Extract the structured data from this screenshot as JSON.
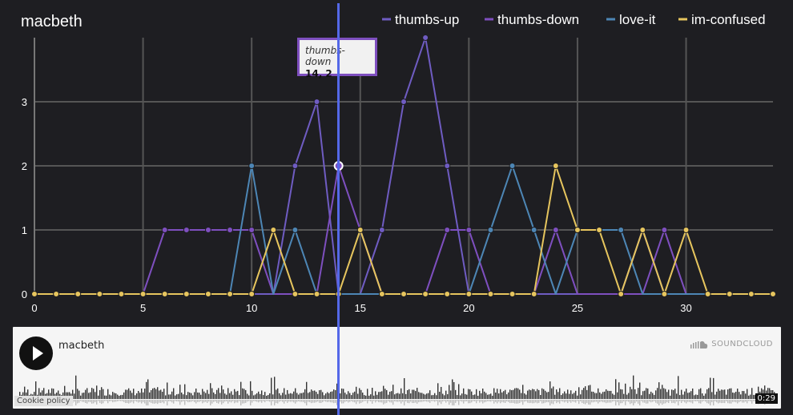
{
  "chart_data": {
    "type": "line",
    "title": "macbeth",
    "xlabel": "",
    "ylabel": "",
    "xlim": [
      0,
      34
    ],
    "ylim": [
      0,
      4
    ],
    "x_ticks": [
      0,
      5,
      10,
      15,
      20,
      25,
      30
    ],
    "y_ticks": [
      0,
      1,
      2,
      3
    ],
    "grid": true,
    "legend_position": "top-right",
    "series": [
      {
        "name": "thumbs-up",
        "color": "#6f5cc2",
        "values": [
          0,
          0,
          0,
          0,
          0,
          0,
          0,
          0,
          0,
          0,
          0,
          0,
          2,
          3,
          0,
          0,
          1,
          3,
          4,
          2,
          0,
          0,
          0,
          0,
          0,
          0,
          0,
          0,
          1,
          0,
          0,
          0,
          0,
          0,
          0
        ]
      },
      {
        "name": "thumbs-down",
        "color": "#7e4fbf",
        "values": [
          0,
          0,
          0,
          0,
          0,
          0,
          1,
          1,
          1,
          1,
          1,
          0,
          0,
          0,
          2,
          1,
          0,
          0,
          0,
          1,
          1,
          0,
          0,
          0,
          1,
          0,
          0,
          0,
          0,
          1,
          0,
          0,
          0,
          0,
          0
        ]
      },
      {
        "name": "love-it",
        "color": "#4d86b5",
        "values": [
          0,
          0,
          0,
          0,
          0,
          0,
          0,
          0,
          0,
          0,
          2,
          0,
          1,
          0,
          0,
          0,
          0,
          0,
          0,
          0,
          0,
          1,
          2,
          1,
          0,
          1,
          1,
          1,
          0,
          0,
          0,
          0,
          0,
          0,
          0
        ]
      },
      {
        "name": "im-confused",
        "color": "#e6c55e",
        "values": [
          0,
          0,
          0,
          0,
          0,
          0,
          0,
          0,
          0,
          0,
          0,
          1,
          0,
          0,
          0,
          1,
          0,
          0,
          0,
          0,
          0,
          0,
          0,
          0,
          2,
          1,
          1,
          0,
          1,
          0,
          1,
          0,
          0,
          0,
          0
        ]
      }
    ],
    "tooltip": {
      "series": "thumbs-down",
      "value": "14, 2"
    },
    "cursor_x": 14
  },
  "player": {
    "title": "macbeth",
    "brand": "SOUNDCLOUD",
    "cookie_policy": "Cookie policy",
    "duration": "0:29"
  },
  "colors": {
    "background": "#1e1e22",
    "grid": "#555555",
    "text": "#ffffff",
    "cursor": "#5468e8",
    "tooltip_border": "#7e4fbf"
  }
}
